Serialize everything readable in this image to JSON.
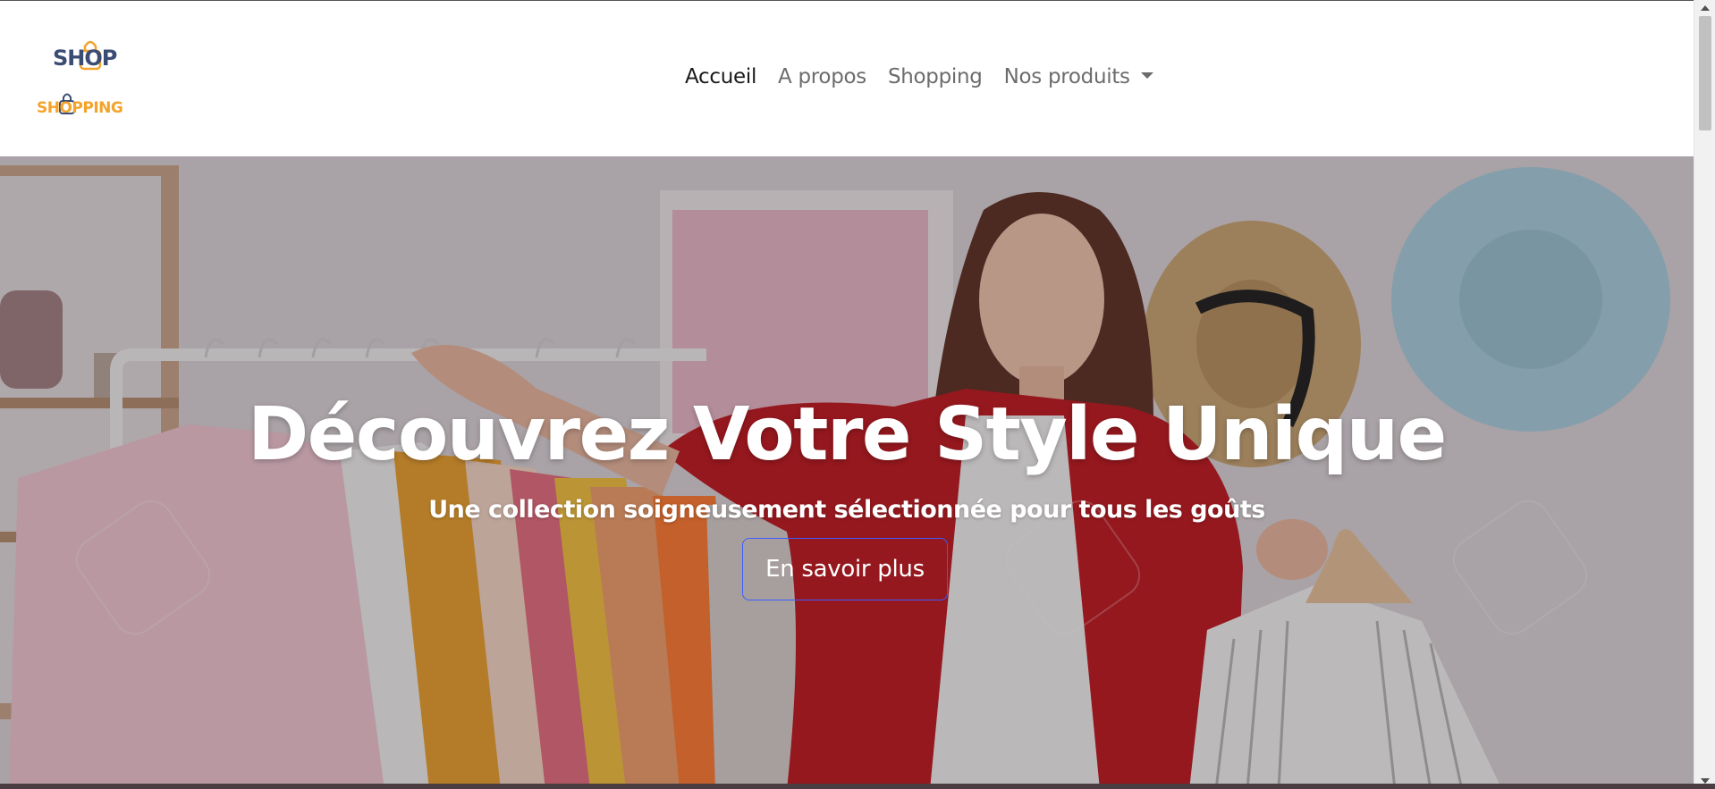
{
  "brand": {
    "logo_top": "SHOP",
    "logo_bottom": "SHOPPING",
    "colors": {
      "navy": "#3b4c74",
      "orange": "#f4a32a"
    }
  },
  "nav": {
    "items": [
      {
        "label": "Accueil",
        "active": true
      },
      {
        "label": "A propos",
        "active": false
      },
      {
        "label": "Shopping",
        "active": false
      },
      {
        "label": "Nos produits",
        "active": false,
        "dropdown": true
      }
    ]
  },
  "hero": {
    "title": "Découvrez Votre Style Unique",
    "subtitle": "Une collection soigneusement sélectionnée pour tous les goûts",
    "cta_label": "En savoir plus",
    "cta_border_color": "#3d5cff",
    "background_icon": "boutique-clothing-rack-photo"
  }
}
